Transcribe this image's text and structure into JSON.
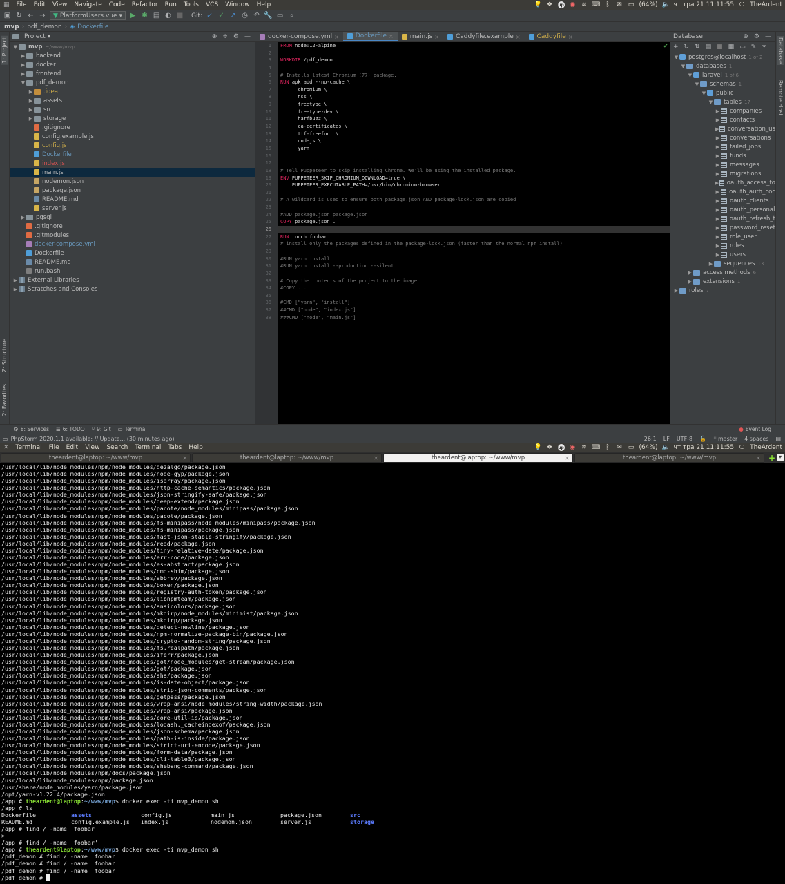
{
  "ide_menubar": {
    "menus": [
      "File",
      "Edit",
      "View",
      "Navigate",
      "Code",
      "Refactor",
      "Run",
      "Tools",
      "VCS",
      "Window",
      "Help"
    ],
    "tray": {
      "battery": "(64%)",
      "clock": "чт тра 21 11:11:55",
      "user": "TheArdent",
      "badge": "up"
    }
  },
  "toolbar": {
    "run_config": "PlatformUsers.vue",
    "git_label": "Git:"
  },
  "breadcrumbs": [
    "mvp",
    "pdf_demon",
    "Dockerfile"
  ],
  "left_strip": {
    "project": "1: Project",
    "structure": "Z: Structure",
    "favorites": "2: Favorites"
  },
  "right_strip": {
    "database": "Database",
    "remote": "Remote Host"
  },
  "project_panel": {
    "title": "Project",
    "tree": [
      {
        "label": "mvp",
        "suffix": "~/www/mvp",
        "depth": 0,
        "kind": "folder",
        "open": true
      },
      {
        "label": "backend",
        "depth": 1,
        "kind": "folder"
      },
      {
        "label": "docker",
        "depth": 1,
        "kind": "folder"
      },
      {
        "label": "frontend",
        "depth": 1,
        "kind": "folder"
      },
      {
        "label": "pdf_demon",
        "depth": 1,
        "kind": "folder",
        "open": true
      },
      {
        "label": ".idea",
        "depth": 2,
        "kind": "idea",
        "color": "#c9a94a"
      },
      {
        "label": "assets",
        "depth": 2,
        "kind": "folder"
      },
      {
        "label": "src",
        "depth": 2,
        "kind": "folder"
      },
      {
        "label": "storage",
        "depth": 2,
        "kind": "folder"
      },
      {
        "label": ".gitignore",
        "depth": 2,
        "kind": "git",
        "leaf": true
      },
      {
        "label": "config.example.js",
        "depth": 2,
        "kind": "js",
        "leaf": true
      },
      {
        "label": "config.js",
        "depth": 2,
        "kind": "js",
        "leaf": true,
        "color": "#c9a94a"
      },
      {
        "label": "Dockerfile",
        "depth": 2,
        "kind": "docker",
        "leaf": true,
        "color": "#6897bb"
      },
      {
        "label": "index.js",
        "depth": 2,
        "kind": "js",
        "leaf": true,
        "color": "#d25252"
      },
      {
        "label": "main.js",
        "depth": 2,
        "kind": "js",
        "leaf": true,
        "selected": true
      },
      {
        "label": "nodemon.json",
        "depth": 2,
        "kind": "json",
        "leaf": true
      },
      {
        "label": "package.json",
        "depth": 2,
        "kind": "json",
        "leaf": true
      },
      {
        "label": "README.md",
        "depth": 2,
        "kind": "md",
        "leaf": true
      },
      {
        "label": "server.js",
        "depth": 2,
        "kind": "js",
        "leaf": true
      },
      {
        "label": "pgsql",
        "depth": 1,
        "kind": "folder"
      },
      {
        "label": ".gitignore",
        "depth": 1,
        "kind": "git",
        "leaf": true
      },
      {
        "label": ".gitmodules",
        "depth": 1,
        "kind": "git",
        "leaf": true
      },
      {
        "label": "docker-compose.yml",
        "depth": 1,
        "kind": "yml",
        "leaf": true,
        "color": "#6897bb"
      },
      {
        "label": "Dockerfile",
        "depth": 1,
        "kind": "docker",
        "leaf": true
      },
      {
        "label": "README.md",
        "depth": 1,
        "kind": "md",
        "leaf": true
      },
      {
        "label": "run.bash",
        "depth": 1,
        "kind": "sh",
        "leaf": true
      },
      {
        "label": "External Libraries",
        "depth": 0,
        "kind": "lib"
      },
      {
        "label": "Scratches and Consoles",
        "depth": 0,
        "kind": "lib"
      }
    ]
  },
  "editor": {
    "tabs": [
      {
        "label": "docker-compose.yml",
        "color": "#bbbbbb"
      },
      {
        "label": "Dockerfile",
        "active": true,
        "color": "#6897bb"
      },
      {
        "label": "main.js",
        "color": "#bbbbbb"
      },
      {
        "label": "Caddyfile.example",
        "color": "#bbbbbb"
      },
      {
        "label": "Caddyfile",
        "color": "#c9a94a"
      }
    ],
    "current_line": 26,
    "lines": [
      [
        [
          "kw",
          "FROM"
        ],
        [
          "t",
          " node:12-alpine"
        ]
      ],
      [],
      [
        [
          "kw",
          "WORKDIR"
        ],
        [
          "t",
          " /pdf_demon"
        ]
      ],
      [],
      [
        [
          "cm",
          "# Installs latest Chromium (77) package."
        ]
      ],
      [
        [
          "kw",
          "RUN"
        ],
        [
          "t",
          " apk add --no-cache \\"
        ]
      ],
      [
        [
          "t",
          "      chromium \\"
        ]
      ],
      [
        [
          "t",
          "      nss \\"
        ]
      ],
      [
        [
          "t",
          "      freetype \\"
        ]
      ],
      [
        [
          "t",
          "      freetype-dev \\"
        ]
      ],
      [
        [
          "t",
          "      harfbuzz \\"
        ]
      ],
      [
        [
          "t",
          "      ca-certificates \\"
        ]
      ],
      [
        [
          "t",
          "      ttf-freefont \\"
        ]
      ],
      [
        [
          "t",
          "      nodejs \\"
        ]
      ],
      [
        [
          "t",
          "      yarn"
        ]
      ],
      [],
      [],
      [
        [
          "cm",
          "# Tell Puppeteer to skip installing Chrome. We'll be using the installed package."
        ]
      ],
      [
        [
          "kw",
          "ENV"
        ],
        [
          "t",
          " PUPPETEER_SKIP_CHROMIUM_DOWNLOAD=true \\"
        ]
      ],
      [
        [
          "t",
          "    PUPPETEER_EXECUTABLE_PATH=/usr/bin/chromium-browser"
        ]
      ],
      [],
      [
        [
          "cm",
          "# A wildcard is used to ensure both package.json AND package-lock.json are copied"
        ]
      ],
      [],
      [
        [
          "cm",
          "#ADD package.json package.json"
        ]
      ],
      [
        [
          "kw",
          "COPY"
        ],
        [
          "t",
          " package.json ."
        ]
      ],
      [],
      [
        [
          "kw",
          "RUN"
        ],
        [
          "t",
          " touch foobar"
        ]
      ],
      [
        [
          "cm",
          "# install only the packages defined in the package-lock.json (faster than the normal npm install)"
        ]
      ],
      [],
      [
        [
          "cm",
          "#RUN yarn install"
        ]
      ],
      [
        [
          "cm",
          "#RUN yarn install --production --silent"
        ]
      ],
      [],
      [
        [
          "cm",
          "# Copy the contents of the project to the image"
        ]
      ],
      [
        [
          "cm",
          "#COPY . ."
        ]
      ],
      [],
      [
        [
          "cm",
          "#CMD [\"yarn\", \"install\"]"
        ]
      ],
      [
        [
          "cm",
          "##CMD [\"node\", \"index.js\"]"
        ]
      ],
      [
        [
          "cm",
          "###CMD [\"node\", \"main.js\"]"
        ]
      ]
    ]
  },
  "database_panel": {
    "title": "Database",
    "tree": [
      {
        "label": "postgres@localhost",
        "count": "1 of 2",
        "depth": 0,
        "kind": "db",
        "open": true
      },
      {
        "label": "databases",
        "count": "1",
        "depth": 1,
        "kind": "folder",
        "open": true
      },
      {
        "label": "laravel",
        "count": "1 of 6",
        "depth": 2,
        "kind": "db",
        "open": true
      },
      {
        "label": "schemas",
        "count": "1",
        "depth": 3,
        "kind": "folder",
        "open": true
      },
      {
        "label": "public",
        "depth": 4,
        "kind": "db",
        "open": true
      },
      {
        "label": "tables",
        "count": "17",
        "depth": 5,
        "kind": "folder",
        "open": true
      },
      {
        "label": "companies",
        "depth": 6,
        "kind": "table"
      },
      {
        "label": "contacts",
        "depth": 6,
        "kind": "table"
      },
      {
        "label": "conversation_us",
        "depth": 6,
        "kind": "table"
      },
      {
        "label": "conversations",
        "depth": 6,
        "kind": "table"
      },
      {
        "label": "failed_jobs",
        "depth": 6,
        "kind": "table"
      },
      {
        "label": "funds",
        "depth": 6,
        "kind": "table"
      },
      {
        "label": "messages",
        "depth": 6,
        "kind": "table"
      },
      {
        "label": "migrations",
        "depth": 6,
        "kind": "table"
      },
      {
        "label": "oauth_access_to",
        "depth": 6,
        "kind": "table"
      },
      {
        "label": "oauth_auth_coc",
        "depth": 6,
        "kind": "table"
      },
      {
        "label": "oauth_clients",
        "depth": 6,
        "kind": "table"
      },
      {
        "label": "oauth_personal",
        "depth": 6,
        "kind": "table"
      },
      {
        "label": "oauth_refresh_t",
        "depth": 6,
        "kind": "table"
      },
      {
        "label": "password_reset",
        "depth": 6,
        "kind": "table"
      },
      {
        "label": "role_user",
        "depth": 6,
        "kind": "table"
      },
      {
        "label": "roles",
        "depth": 6,
        "kind": "table"
      },
      {
        "label": "users",
        "depth": 6,
        "kind": "table"
      },
      {
        "label": "sequences",
        "count": "13",
        "depth": 5,
        "kind": "folder"
      },
      {
        "label": "access methods",
        "count": "6",
        "depth": 2,
        "kind": "folder"
      },
      {
        "label": "extensions",
        "count": "1",
        "depth": 2,
        "kind": "folder"
      },
      {
        "label": "roles",
        "count": "7",
        "depth": 0,
        "kind": "folder"
      }
    ]
  },
  "bottom_tools": [
    "8: Services",
    "6: TODO",
    "9: Git",
    "Terminal"
  ],
  "event_log": "Event Log",
  "statusbar": {
    "message": "PhpStorm 2020.1.1 available: // Update... (30 minutes ago)",
    "position": "26:1",
    "line_sep": "LF",
    "encoding": "UTF-8",
    "branch": "master",
    "indent": "4 spaces"
  },
  "terminal_menubar": {
    "menus": [
      "Terminal",
      "File",
      "Edit",
      "View",
      "Search",
      "Terminal",
      "Tabs",
      "Help"
    ]
  },
  "terminal": {
    "tabs": [
      {
        "label": "theardent@laptop: ~/www/mvp"
      },
      {
        "label": "theardent@laptop: ~/www/mvp"
      },
      {
        "label": "theardent@laptop: ~/www/mvp",
        "active": true
      },
      {
        "label": "theardent@laptop: ~/www/mvp"
      }
    ],
    "prompt": {
      "user": "theardent@laptop",
      "path": "~/www/mvp"
    },
    "lines": [
      {
        "t": "/usr/local/lib/node_modules/npm/node_modules/dezalgo/package.json"
      },
      {
        "t": "/usr/local/lib/node_modules/npm/node_modules/node-gyp/package.json"
      },
      {
        "t": "/usr/local/lib/node_modules/npm/node_modules/isarray/package.json"
      },
      {
        "t": "/usr/local/lib/node_modules/npm/node_modules/http-cache-semantics/package.json"
      },
      {
        "t": "/usr/local/lib/node_modules/npm/node_modules/json-stringify-safe/package.json"
      },
      {
        "t": "/usr/local/lib/node_modules/npm/node_modules/deep-extend/package.json"
      },
      {
        "t": "/usr/local/lib/node_modules/npm/node_modules/pacote/node_modules/minipass/package.json"
      },
      {
        "t": "/usr/local/lib/node_modules/npm/node_modules/pacote/package.json"
      },
      {
        "t": "/usr/local/lib/node_modules/npm/node_modules/fs-minipass/node_modules/minipass/package.json"
      },
      {
        "t": "/usr/local/lib/node_modules/npm/node_modules/fs-minipass/package.json"
      },
      {
        "t": "/usr/local/lib/node_modules/npm/node_modules/fast-json-stable-stringify/package.json"
      },
      {
        "t": "/usr/local/lib/node_modules/npm/node_modules/read/package.json"
      },
      {
        "t": "/usr/local/lib/node_modules/npm/node_modules/tiny-relative-date/package.json"
      },
      {
        "t": "/usr/local/lib/node_modules/npm/node_modules/err-code/package.json"
      },
      {
        "t": "/usr/local/lib/node_modules/npm/node_modules/es-abstract/package.json"
      },
      {
        "t": "/usr/local/lib/node_modules/npm/node_modules/cmd-shim/package.json"
      },
      {
        "t": "/usr/local/lib/node_modules/npm/node_modules/abbrev/package.json"
      },
      {
        "t": "/usr/local/lib/node_modules/npm/node_modules/boxen/package.json"
      },
      {
        "t": "/usr/local/lib/node_modules/npm/node_modules/registry-auth-token/package.json"
      },
      {
        "t": "/usr/local/lib/node_modules/npm/node_modules/libnpmteam/package.json"
      },
      {
        "t": "/usr/local/lib/node_modules/npm/node_modules/ansicolors/package.json"
      },
      {
        "t": "/usr/local/lib/node_modules/npm/node_modules/mkdirp/node_modules/minimist/package.json"
      },
      {
        "t": "/usr/local/lib/node_modules/npm/node_modules/mkdirp/package.json"
      },
      {
        "t": "/usr/local/lib/node_modules/npm/node_modules/detect-newline/package.json"
      },
      {
        "t": "/usr/local/lib/node_modules/npm/node_modules/npm-normalize-package-bin/package.json"
      },
      {
        "t": "/usr/local/lib/node_modules/npm/node_modules/crypto-random-string/package.json"
      },
      {
        "t": "/usr/local/lib/node_modules/npm/node_modules/fs.realpath/package.json"
      },
      {
        "t": "/usr/local/lib/node_modules/npm/node_modules/iferr/package.json"
      },
      {
        "t": "/usr/local/lib/node_modules/npm/node_modules/got/node_modules/get-stream/package.json"
      },
      {
        "t": "/usr/local/lib/node_modules/npm/node_modules/got/package.json"
      },
      {
        "t": "/usr/local/lib/node_modules/npm/node_modules/sha/package.json"
      },
      {
        "t": "/usr/local/lib/node_modules/npm/node_modules/is-date-object/package.json"
      },
      {
        "t": "/usr/local/lib/node_modules/npm/node_modules/strip-json-comments/package.json"
      },
      {
        "t": "/usr/local/lib/node_modules/npm/node_modules/getpass/package.json"
      },
      {
        "t": "/usr/local/lib/node_modules/npm/node_modules/wrap-ansi/node_modules/string-width/package.json"
      },
      {
        "t": "/usr/local/lib/node_modules/npm/node_modules/wrap-ansi/package.json"
      },
      {
        "t": "/usr/local/lib/node_modules/npm/node_modules/core-util-is/package.json"
      },
      {
        "t": "/usr/local/lib/node_modules/npm/node_modules/lodash._cacheindexof/package.json"
      },
      {
        "t": "/usr/local/lib/node_modules/npm/node_modules/json-schema/package.json"
      },
      {
        "t": "/usr/local/lib/node_modules/npm/node_modules/path-is-inside/package.json"
      },
      {
        "t": "/usr/local/lib/node_modules/npm/node_modules/strict-uri-encode/package.json"
      },
      {
        "t": "/usr/local/lib/node_modules/npm/node_modules/form-data/package.json"
      },
      {
        "t": "/usr/local/lib/node_modules/npm/node_modules/cli-table3/package.json"
      },
      {
        "t": "/usr/local/lib/node_modules/npm/node_modules/shebang-command/package.json"
      },
      {
        "t": "/usr/local/lib/node_modules/npm/docs/package.json"
      },
      {
        "t": "/usr/local/lib/node_modules/npm/package.json"
      },
      {
        "t": "/usr/share/node_modules/yarn/package.json"
      },
      {
        "t": "/opt/yarn-v1.22.4/package.json"
      },
      {
        "t": "/app # ",
        "prompt_after": true,
        "cmd": " docker exec -ti mvp_demon sh"
      },
      {
        "t": "/app # ls"
      },
      {
        "ls": [
          "Dockerfile",
          "assets",
          "config.js",
          "main.js",
          "package.json",
          "src"
        ]
      },
      {
        "ls": [
          "README.md",
          "config.example.js",
          "index.js",
          "nodemon.json",
          "server.js",
          "storage"
        ]
      },
      {
        "t": "/app # find / -name 'foobar"
      },
      {
        "t": "> '"
      },
      {
        "t": "/app # find / -name 'foobar'"
      },
      {
        "t": "/app # ",
        "prompt_after": true,
        "cmd": " docker exec -ti mvp_demon sh"
      },
      {
        "t": "/pdf_demon # find / -name 'foobar'"
      },
      {
        "t": "/pdf_demon # find / -name 'foobar'"
      },
      {
        "t": "/pdf_demon # find / -name 'foobar'"
      },
      {
        "t": "/pdf_demon # ",
        "cursor": true
      }
    ]
  }
}
